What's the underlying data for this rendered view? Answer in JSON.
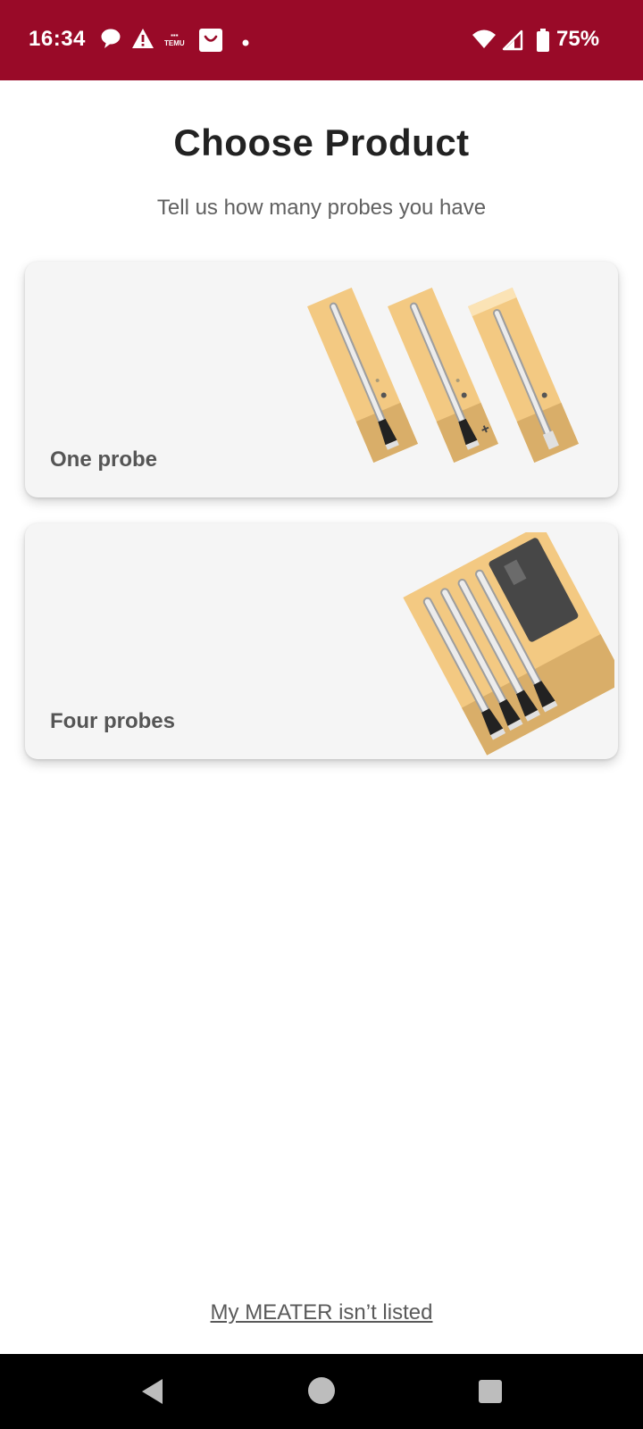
{
  "status_bar": {
    "time": "16:34",
    "temu_label": "TEMU",
    "battery_percent": "75%",
    "icons": [
      "chat-bubble-icon",
      "warning-icon",
      "temu-icon",
      "shopping-bag-icon",
      "dot-icon",
      "wifi-icon",
      "signal-icon",
      "battery-icon"
    ],
    "background": "#990a28"
  },
  "page": {
    "title": "Choose Product",
    "subtitle": "Tell us how many probes you have"
  },
  "options": [
    {
      "label": "One probe",
      "image": "three-single-probe-boxes"
    },
    {
      "label": "Four probes",
      "image": "four-probe-block"
    }
  ],
  "footer": {
    "link": "My MEATER isn’t listed"
  },
  "nav_bar": {
    "buttons": [
      "back-icon",
      "home-icon",
      "recents-icon"
    ]
  },
  "colors": {
    "card_background": "#f5f5f5",
    "wood_light": "#f3c982",
    "wood_dark": "#d9ae69",
    "text_primary": "#222222",
    "text_secondary": "#606060"
  }
}
